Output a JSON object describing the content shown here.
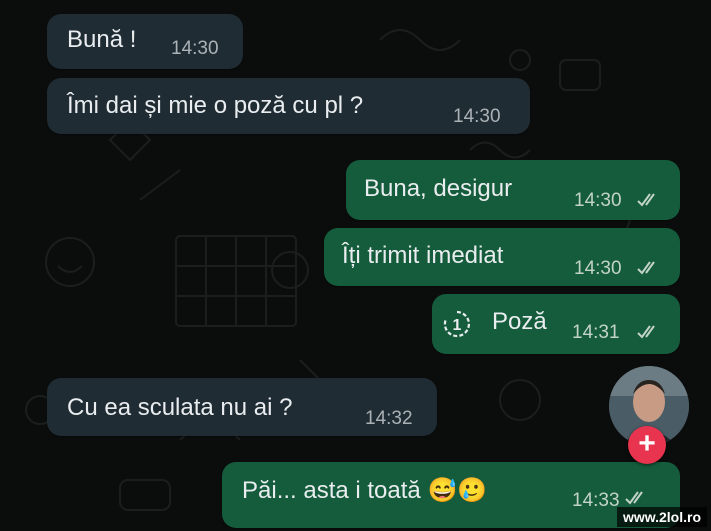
{
  "messages": [
    {
      "direction": "incoming",
      "text": "Bună !",
      "time": "14:30"
    },
    {
      "direction": "incoming",
      "text": "Îmi dai și mie o poză cu pl ?",
      "time": "14:30"
    },
    {
      "direction": "outgoing",
      "text": "Buna, desigur",
      "time": "14:30",
      "status": "read"
    },
    {
      "direction": "outgoing",
      "text": "Îți trimit imediat",
      "time": "14:30",
      "status": "read"
    },
    {
      "direction": "outgoing",
      "text": "Poză",
      "time": "14:31",
      "status": "read",
      "view_once": true,
      "view_once_label": "1"
    },
    {
      "direction": "incoming",
      "text": "Cu ea sculata nu ai ?",
      "time": "14:32"
    },
    {
      "direction": "outgoing",
      "text": "Păi... asta i toată",
      "emojis": [
        "😅",
        "🥲"
      ],
      "time": "14:33",
      "status": "read"
    }
  ],
  "watermark": "www.2lol.ro",
  "colors": {
    "background": "#0b0d0c",
    "incoming_bubble": "#202c33",
    "outgoing_bubble": "#145c3b",
    "read_ticks": "#c3d3c9",
    "add_button": "#e8344e"
  },
  "icons": {
    "read_status": "double-check-icon",
    "view_once": "view-once-icon",
    "add": "plus-icon"
  }
}
